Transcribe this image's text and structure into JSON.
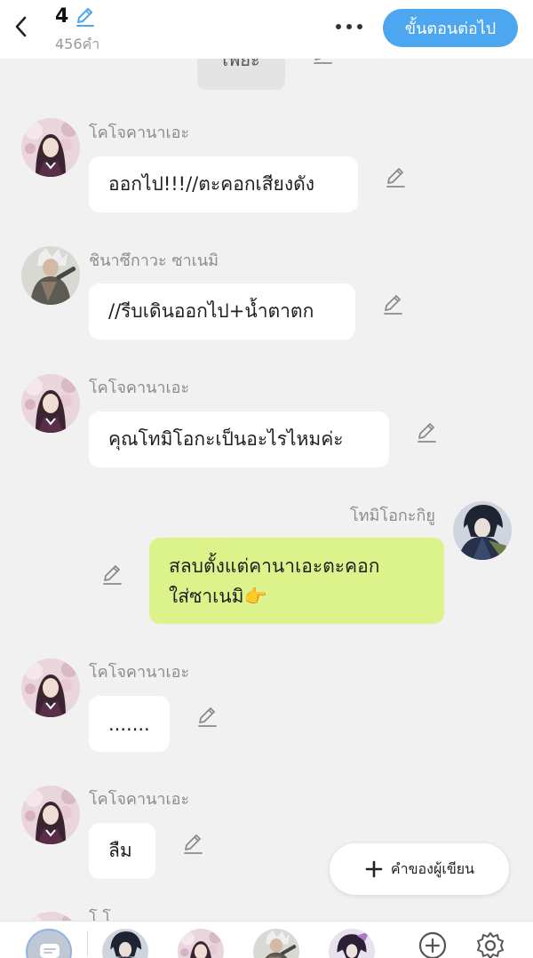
{
  "header": {
    "chapter_number": "4",
    "word_count": "456คำ",
    "next_step_label": "ขั้นตอนต่อไป"
  },
  "partial_message": {
    "text": "เพียะ"
  },
  "characters": {
    "kocho": "โคโจคานาเอะ",
    "shinazugawa": "ชินาซึกาวะ ซาเนมิ",
    "tomioka": "โทมิโอกะกิยู"
  },
  "messages": [
    {
      "sender": "โคโจคานาเอะ",
      "side": "left",
      "text": "ออกไป!!!//ตะคอกเสียงดัง"
    },
    {
      "sender": "ชินาซึกาวะ ซาเนมิ",
      "side": "left",
      "text": "//รีบเดินออกไป+น้ำตาตก"
    },
    {
      "sender": "โคโจคานาเอะ",
      "side": "left",
      "text": "คุณโทมิโอกะเป็นอะไรไหมค่ะ"
    },
    {
      "sender": "โทมิโอกะกิยู",
      "side": "right",
      "lines": [
        "สลบตั้งแต่คานาเอะตะคอก",
        "ใส่ซาเนมิ👉"
      ]
    },
    {
      "sender": "โคโจคานาเอะ",
      "side": "left",
      "text": "......."
    },
    {
      "sender": "โคโจคานาเอะ",
      "side": "left",
      "text": "ลืม"
    }
  ],
  "peek_message": {
    "sender": "โ.โ"
  },
  "author_note": {
    "label": "คำของผู้เขียน"
  },
  "colors": {
    "accent": "#4da6f0",
    "right_bubble": "#dcf38c",
    "background": "#f1f1f1",
    "left_bubble": "#ffffff"
  },
  "icons": [
    "back-icon",
    "pencil-icon",
    "more-icon",
    "plus-icon",
    "chat-icon",
    "add-circle-icon",
    "gear-icon"
  ]
}
